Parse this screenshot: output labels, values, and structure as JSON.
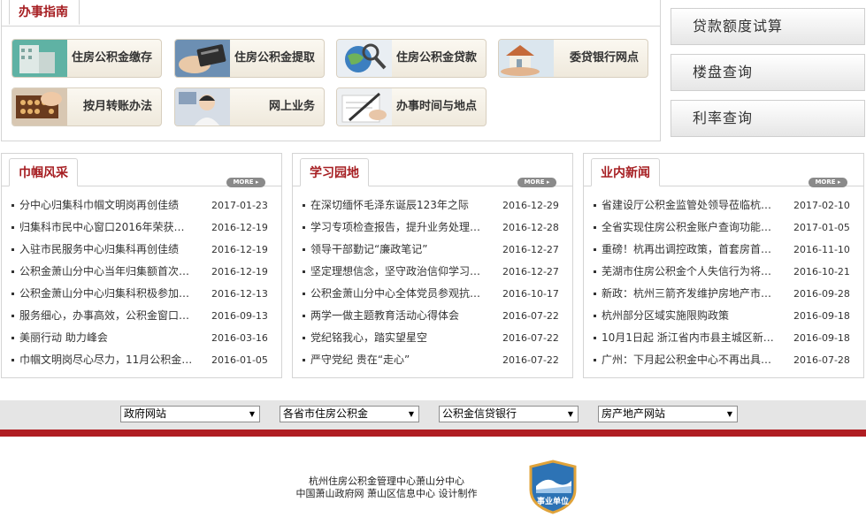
{
  "guide": {
    "tab": "办事指南",
    "buttons": [
      {
        "label": "住房公积金缴存"
      },
      {
        "label": "住房公积金提取"
      },
      {
        "label": "住房公积金贷款"
      },
      {
        "label": "委贷银行网点"
      },
      {
        "label": "按月转账办法"
      },
      {
        "label": "网上业务"
      },
      {
        "label": "办事时间与地点"
      }
    ]
  },
  "side_buttons": [
    "贷款额度试算",
    "楼盘查询",
    "利率查询"
  ],
  "panels": [
    {
      "title": "巾帼风采",
      "more": "MORE ▸",
      "items": [
        {
          "title": "分中心归集科巾帼文明岗再创佳绩",
          "date": "2017-01-23"
        },
        {
          "title": "归集科市民中心窗口2016年荣获红旗…",
          "date": "2016-12-19"
        },
        {
          "title": "入驻市民服务中心归集科再创佳绩",
          "date": "2016-12-19"
        },
        {
          "title": "公积金萧山分中心当年归集额首次突…",
          "date": "2016-12-19"
        },
        {
          "title": "公积金萧山分中心归集科积极参加区…",
          "date": "2016-12-13"
        },
        {
          "title": "服务细心，办事高效，公积金窗口姑…",
          "date": "2016-09-13"
        },
        {
          "title": "美丽行动 助力峰会",
          "date": "2016-03-16"
        },
        {
          "title": "巾帼文明岗尽心尽力，11月公积金贷…",
          "date": "2016-01-05"
        }
      ]
    },
    {
      "title": "学习园地",
      "more": "MORE ▸",
      "items": [
        {
          "title": "在深切缅怀毛泽东诞辰123年之际",
          "date": "2016-12-29"
        },
        {
          "title": "学习专项检查报告，提升业务处理能力",
          "date": "2016-12-28"
        },
        {
          "title": "领导干部勤记“廉政笔记”",
          "date": "2016-12-27"
        },
        {
          "title": "坚定理想信念，坚守政治信仰学习体会",
          "date": "2016-12-27"
        },
        {
          "title": "公积金萧山分中心全体党员参观抗战…",
          "date": "2016-10-17"
        },
        {
          "title": "两学一做主题教育活动心得体会",
          "date": "2016-07-22"
        },
        {
          "title": "党纪铭我心，踏实望星空",
          "date": "2016-07-22"
        },
        {
          "title": "严守党纪 贵在“走心”",
          "date": "2016-07-22"
        }
      ]
    },
    {
      "title": "业内新闻",
      "more": "MORE ▸",
      "items": [
        {
          "title": "省建设厅公积金监管处领导莅临杭州…",
          "date": "2017-02-10"
        },
        {
          "title": "全省实现住房公积金账户查询功能全…",
          "date": "2017-01-05"
        },
        {
          "title": "重磅！杭再出调控政策，首套房首付…",
          "date": "2016-11-10"
        },
        {
          "title": "芜湖市住房公积金个人失信行为将有…",
          "date": "2016-10-21"
        },
        {
          "title": "新政：杭州三箭齐发维护房地产市场…",
          "date": "2016-09-28"
        },
        {
          "title": "杭州部分区域实施限购政策",
          "date": "2016-09-18"
        },
        {
          "title": "10月1日起 浙江省内市县主城区新建…",
          "date": "2016-09-18"
        },
        {
          "title": "广州：下月起公积金中心不再出具缴…",
          "date": "2016-07-28"
        }
      ]
    }
  ],
  "links": [
    "政府网站",
    "各省市住房公积金",
    "公积金信贷银行",
    "房产地产网站"
  ],
  "footer": {
    "line1": "杭州住房公积金管理中心萧山分中心",
    "line2": "中国萧山政府网 萧山区信息中心 设计制作",
    "badge": "事业单位"
  },
  "colors": {
    "accent": "#a61e22",
    "redbar": "#b01d22"
  }
}
